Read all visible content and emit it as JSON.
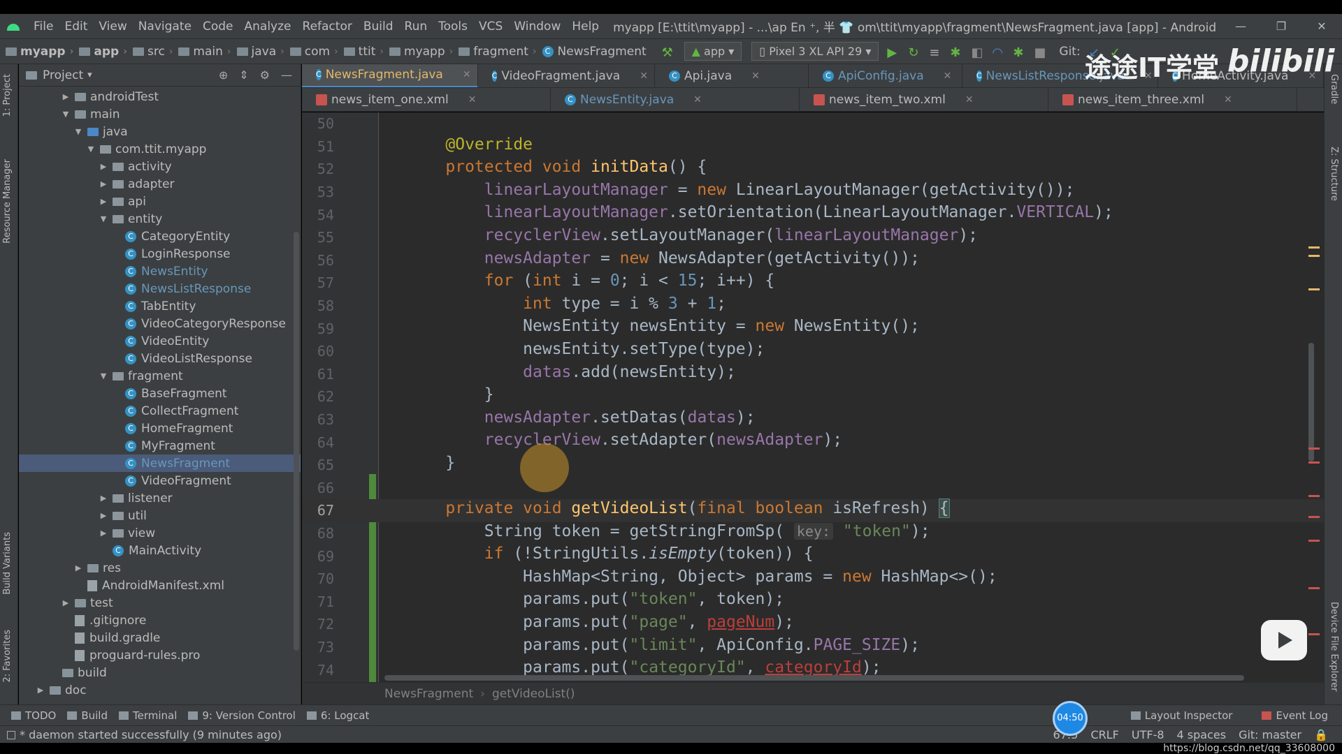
{
  "menu": {
    "items": [
      "File",
      "Edit",
      "View",
      "Navigate",
      "Code",
      "Analyze",
      "Refactor",
      "Build",
      "Run",
      "Tools",
      "VCS",
      "Window",
      "Help"
    ],
    "title": "myapp [E:\\ttit\\myapp] - ...\\ap En ⁺, 半 👕 om\\ttit\\myapp\\fragment\\NewsFragment.java [app] - Android Studio"
  },
  "nav": {
    "crumbs": [
      "myapp",
      "app",
      "src",
      "main",
      "java",
      "com",
      "ttit",
      "myapp",
      "fragment"
    ],
    "file": "NewsFragment",
    "config": "app",
    "device": "Pixel 3 XL API 29",
    "git": "Git:"
  },
  "project": {
    "header": "Project",
    "tree": [
      {
        "label": "androidTest",
        "depth": 3,
        "arrow": "▶",
        "icon": "folder"
      },
      {
        "label": "main",
        "depth": 3,
        "arrow": "▼",
        "icon": "folder"
      },
      {
        "label": "java",
        "depth": 4,
        "arrow": "▼",
        "icon": "folder-blue"
      },
      {
        "label": "com.ttit.myapp",
        "depth": 5,
        "arrow": "▼",
        "icon": "package"
      },
      {
        "label": "activity",
        "depth": 6,
        "arrow": "▶",
        "icon": "package"
      },
      {
        "label": "adapter",
        "depth": 6,
        "arrow": "▶",
        "icon": "package"
      },
      {
        "label": "api",
        "depth": 6,
        "arrow": "▶",
        "icon": "package"
      },
      {
        "label": "entity",
        "depth": 6,
        "arrow": "▼",
        "icon": "package"
      },
      {
        "label": "CategoryEntity",
        "depth": 7,
        "arrow": "",
        "icon": "class"
      },
      {
        "label": "LoginResponse",
        "depth": 7,
        "arrow": "",
        "icon": "class"
      },
      {
        "label": "NewsEntity",
        "depth": 7,
        "arrow": "",
        "icon": "class",
        "color": "blue"
      },
      {
        "label": "NewsListResponse",
        "depth": 7,
        "arrow": "",
        "icon": "class",
        "color": "blue"
      },
      {
        "label": "TabEntity",
        "depth": 7,
        "arrow": "",
        "icon": "class"
      },
      {
        "label": "VideoCategoryResponse",
        "depth": 7,
        "arrow": "",
        "icon": "class"
      },
      {
        "label": "VideoEntity",
        "depth": 7,
        "arrow": "",
        "icon": "class"
      },
      {
        "label": "VideoListResponse",
        "depth": 7,
        "arrow": "",
        "icon": "class"
      },
      {
        "label": "fragment",
        "depth": 6,
        "arrow": "▼",
        "icon": "package"
      },
      {
        "label": "BaseFragment",
        "depth": 7,
        "arrow": "",
        "icon": "class"
      },
      {
        "label": "CollectFragment",
        "depth": 7,
        "arrow": "",
        "icon": "class"
      },
      {
        "label": "HomeFragment",
        "depth": 7,
        "arrow": "",
        "icon": "class"
      },
      {
        "label": "MyFragment",
        "depth": 7,
        "arrow": "",
        "icon": "class"
      },
      {
        "label": "NewsFragment",
        "depth": 7,
        "arrow": "",
        "icon": "class",
        "selected": true,
        "color": "blue"
      },
      {
        "label": "VideoFragment",
        "depth": 7,
        "arrow": "",
        "icon": "class"
      },
      {
        "label": "listener",
        "depth": 6,
        "arrow": "▶",
        "icon": "package"
      },
      {
        "label": "util",
        "depth": 6,
        "arrow": "▶",
        "icon": "package"
      },
      {
        "label": "view",
        "depth": 6,
        "arrow": "▶",
        "icon": "package"
      },
      {
        "label": "MainActivity",
        "depth": 6,
        "arrow": "",
        "icon": "class"
      },
      {
        "label": "res",
        "depth": 4,
        "arrow": "▶",
        "icon": "folder"
      },
      {
        "label": "AndroidManifest.xml",
        "depth": 4,
        "arrow": "",
        "icon": "file"
      },
      {
        "label": "test",
        "depth": 3,
        "arrow": "▶",
        "icon": "folder"
      },
      {
        "label": ".gitignore",
        "depth": 3,
        "arrow": "",
        "icon": "file"
      },
      {
        "label": "build.gradle",
        "depth": 3,
        "arrow": "",
        "icon": "file"
      },
      {
        "label": "proguard-rules.pro",
        "depth": 3,
        "arrow": "",
        "icon": "file"
      },
      {
        "label": "build",
        "depth": 2,
        "arrow": "",
        "icon": "folder"
      },
      {
        "label": "doc",
        "depth": 1,
        "arrow": "▶",
        "icon": "folder"
      }
    ]
  },
  "tabs_row1": [
    {
      "label": "NewsFragment.java",
      "type": "class",
      "state": "active"
    },
    {
      "label": "VideoFragment.java",
      "type": "class"
    },
    {
      "label": "Api.java",
      "type": "class"
    },
    {
      "label": "ApiConfig.java",
      "type": "class",
      "state": "mod"
    },
    {
      "label": "NewsListResponse.java",
      "type": "class",
      "state": "mod"
    },
    {
      "label": "HomeActivity.java",
      "type": "class"
    }
  ],
  "tabs_row2": [
    {
      "label": "news_item_one.xml",
      "type": "xml"
    },
    {
      "label": "NewsEntity.java",
      "type": "class",
      "state": "mod"
    },
    {
      "label": "news_item_two.xml",
      "type": "xml"
    },
    {
      "label": "news_item_three.xml",
      "type": "xml"
    }
  ],
  "editor": {
    "current_line": 67,
    "lines": [
      {
        "n": 50,
        "t": []
      },
      {
        "n": 51,
        "t": [
          [
            "ann",
            "    @Override"
          ]
        ]
      },
      {
        "n": 52,
        "t": [
          [
            "kw",
            "    protected void "
          ],
          [
            "fn",
            "initData"
          ],
          [
            "txt",
            "() {"
          ]
        ]
      },
      {
        "n": 53,
        "t": [
          [
            "fld",
            "        linearLayoutManager"
          ],
          [
            "txt",
            " = "
          ],
          [
            "kw",
            "new "
          ],
          [
            "txt",
            "LinearLayoutManager(getActivity());"
          ]
        ]
      },
      {
        "n": 54,
        "t": [
          [
            "fld",
            "        linearLayoutManager"
          ],
          [
            "txt",
            ".setOrientation(LinearLayoutManager."
          ],
          [
            "fld",
            "VERTICAL"
          ],
          [
            "txt",
            ");"
          ]
        ]
      },
      {
        "n": 55,
        "t": [
          [
            "fld",
            "        recyclerView"
          ],
          [
            "txt",
            ".setLayoutManager("
          ],
          [
            "fld",
            "linearLayoutManager"
          ],
          [
            "txt",
            ");"
          ]
        ]
      },
      {
        "n": 56,
        "t": [
          [
            "fld",
            "        newsAdapter"
          ],
          [
            "txt",
            " = "
          ],
          [
            "kw",
            "new "
          ],
          [
            "txt",
            "NewsAdapter(getActivity());"
          ]
        ]
      },
      {
        "n": 57,
        "t": [
          [
            "kw",
            "        for "
          ],
          [
            "txt",
            "("
          ],
          [
            "kw",
            "int "
          ],
          [
            "txt",
            "i = "
          ],
          [
            "num",
            "0"
          ],
          [
            "txt",
            "; i < "
          ],
          [
            "num",
            "15"
          ],
          [
            "txt",
            "; i++) {"
          ]
        ]
      },
      {
        "n": 58,
        "t": [
          [
            "kw",
            "            int "
          ],
          [
            "txt",
            "type = i % "
          ],
          [
            "num",
            "3"
          ],
          [
            "txt",
            " + "
          ],
          [
            "num",
            "1"
          ],
          [
            "txt",
            ";"
          ]
        ]
      },
      {
        "n": 59,
        "t": [
          [
            "txt",
            "            NewsEntity newsEntity = "
          ],
          [
            "kw",
            "new "
          ],
          [
            "txt",
            "NewsEntity();"
          ]
        ]
      },
      {
        "n": 60,
        "t": [
          [
            "txt",
            "            newsEntity.setType(type);"
          ]
        ]
      },
      {
        "n": 61,
        "t": [
          [
            "fld",
            "            datas"
          ],
          [
            "txt",
            ".add(newsEntity);"
          ]
        ]
      },
      {
        "n": 62,
        "t": [
          [
            "txt",
            "        }"
          ]
        ]
      },
      {
        "n": 63,
        "t": [
          [
            "fld",
            "        newsAdapter"
          ],
          [
            "txt",
            ".setDatas("
          ],
          [
            "fld",
            "datas"
          ],
          [
            "txt",
            ");"
          ]
        ]
      },
      {
        "n": 64,
        "t": [
          [
            "fld",
            "        recyclerView"
          ],
          [
            "txt",
            ".setAdapter("
          ],
          [
            "fld",
            "newsAdapter"
          ],
          [
            "txt",
            ");"
          ]
        ]
      },
      {
        "n": 65,
        "t": [
          [
            "txt",
            "    }"
          ]
        ]
      },
      {
        "n": 66,
        "t": []
      },
      {
        "n": 67,
        "t": [
          [
            "kw",
            "    private void "
          ],
          [
            "fn",
            "getVideoList"
          ],
          [
            "txt",
            "("
          ],
          [
            "kw",
            "final boolean "
          ],
          [
            "txt",
            "isRefresh) "
          ],
          [
            "bracket",
            "{"
          ]
        ]
      },
      {
        "n": 68,
        "t": [
          [
            "txt",
            "        String token = getStringFromSp( "
          ],
          [
            "hint",
            "key:"
          ],
          [
            "str",
            " \"token\""
          ],
          [
            "txt",
            ");"
          ]
        ]
      },
      {
        "n": 69,
        "t": [
          [
            "kw",
            "        if "
          ],
          [
            "txt",
            "(!StringUtils."
          ],
          [
            "it",
            "isEmpty"
          ],
          [
            "txt",
            "(token)) {"
          ]
        ]
      },
      {
        "n": 70,
        "t": [
          [
            "txt",
            "            HashMap<String, Object> params = "
          ],
          [
            "kw",
            "new "
          ],
          [
            "txt",
            "HashMap<>();"
          ]
        ]
      },
      {
        "n": 71,
        "t": [
          [
            "txt",
            "            params.put("
          ],
          [
            "str",
            "\"token\""
          ],
          [
            "txt",
            ", token);"
          ]
        ]
      },
      {
        "n": 72,
        "t": [
          [
            "txt",
            "            params.put("
          ],
          [
            "str",
            "\"page\""
          ],
          [
            "txt",
            ", "
          ],
          [
            "err",
            "pageNum"
          ],
          [
            "txt",
            ");"
          ]
        ]
      },
      {
        "n": 73,
        "t": [
          [
            "txt",
            "            params.put("
          ],
          [
            "str",
            "\"limit\""
          ],
          [
            "txt",
            ", ApiConfig."
          ],
          [
            "fld",
            "PAGE_SIZE"
          ],
          [
            "txt",
            ");"
          ]
        ]
      },
      {
        "n": 74,
        "t": [
          [
            "txt",
            "            params.put("
          ],
          [
            "str",
            "\"categoryId\""
          ],
          [
            "txt",
            ", "
          ],
          [
            "err",
            "categoryId"
          ],
          [
            "txt",
            ");"
          ]
        ]
      }
    ]
  },
  "editor_crumb": [
    "NewsFragment",
    "getVideoList()"
  ],
  "bottom_tools": {
    "left": [
      "TODO",
      "Build",
      "Terminal",
      "9: Version Control",
      "6: Logcat"
    ],
    "right": [
      "Layout Inspector",
      "Event Log"
    ]
  },
  "side_tabs": {
    "left_top": [
      "1: Project",
      "Resource Manager"
    ],
    "left_bottom": [
      "Build Variants",
      "2: Favorites"
    ],
    "right_top": [
      "Gradle",
      "Z: Structure"
    ],
    "right_bottom": [
      "Device File Explorer"
    ]
  },
  "status": {
    "message": "* daemon started successfully (9 minutes ago)",
    "position": "67:5",
    "line_sep": "CRLF",
    "encoding": "UTF-8",
    "indent": "4 spaces",
    "branch": "Git: master"
  },
  "video": {
    "timer": "04:50",
    "watermark_text": "途途IT学堂",
    "watermark_logo": "bilibili",
    "url": "https://blog.csdn.net/qq_33608000"
  }
}
